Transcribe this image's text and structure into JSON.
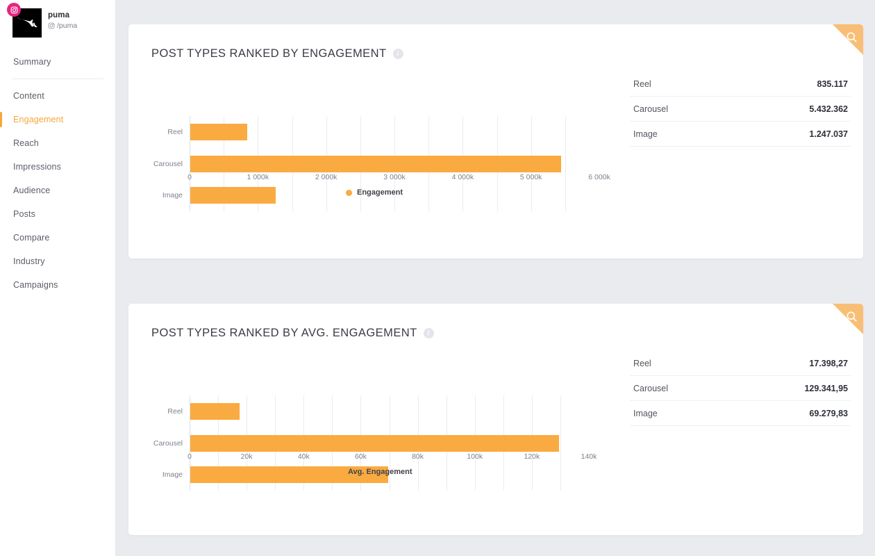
{
  "sidebar": {
    "profile": {
      "name": "puma",
      "handle": "/puma",
      "network_icon": "instagram-icon",
      "avatar_icon": "puma-logo"
    },
    "items": [
      {
        "label": "Summary",
        "active": false
      },
      {
        "label": "Content",
        "active": false
      },
      {
        "label": "Engagement",
        "active": true
      },
      {
        "label": "Reach",
        "active": false
      },
      {
        "label": "Impressions",
        "active": false
      },
      {
        "label": "Audience",
        "active": false
      },
      {
        "label": "Posts",
        "active": false
      },
      {
        "label": "Compare",
        "active": false
      },
      {
        "label": "Industry",
        "active": false
      },
      {
        "label": "Campaigns",
        "active": false
      }
    ]
  },
  "colors": {
    "accent": "#f5a73b",
    "bar": "#f9ab41",
    "corner": "#f9be75",
    "page_background": "#eaebef",
    "brand_badge": "#e6257e"
  },
  "cards": [
    {
      "title": "POST TYPES RANKED BY ENGAGEMENT",
      "info_icon": "info-icon",
      "corner_icon": "magnifier-icon",
      "table": {
        "rows": [
          {
            "name": "Reel",
            "value": "835.117"
          },
          {
            "name": "Carousel",
            "value": "5.432.362"
          },
          {
            "name": "Image",
            "value": "1.247.037"
          }
        ]
      }
    },
    {
      "title": "POST TYPES RANKED BY AVG. ENGAGEMENT",
      "info_icon": "info-icon",
      "corner_icon": "magnifier-icon",
      "table": {
        "rows": [
          {
            "name": "Reel",
            "value": "17.398,27"
          },
          {
            "name": "Carousel",
            "value": "129.341,95"
          },
          {
            "name": "Image",
            "value": "69.279,83"
          }
        ]
      }
    }
  ],
  "chart_data": [
    {
      "type": "bar",
      "orientation": "horizontal",
      "title": "POST TYPES RANKED BY ENGAGEMENT",
      "categories": [
        "Reel",
        "Carousel",
        "Image"
      ],
      "values": [
        835117,
        5432362,
        1247037
      ],
      "series": [
        {
          "name": "Engagement",
          "values": [
            835117,
            5432362,
            1247037
          ]
        }
      ],
      "legend": [
        "Engagement"
      ],
      "legend_position": "bottom",
      "xlabel": "",
      "ylabel": "",
      "xlim": [
        0,
        6000000
      ],
      "xtick_values": [
        0,
        1000000,
        2000000,
        3000000,
        4000000,
        5000000,
        6000000
      ],
      "xtick_labels": [
        "0",
        "1 000k",
        "2 000k",
        "3 000k",
        "4 000k",
        "5 000k",
        "6 000k"
      ],
      "minor_gridline_step": 500000,
      "grid": true,
      "bar_color": "#f9ab41"
    },
    {
      "type": "bar",
      "orientation": "horizontal",
      "title": "POST TYPES RANKED BY AVG. ENGAGEMENT",
      "categories": [
        "Reel",
        "Carousel",
        "Image"
      ],
      "values": [
        17398.27,
        129341.95,
        69279.83
      ],
      "series": [
        {
          "name": "Avg. Engagement",
          "values": [
            17398.27,
            129341.95,
            69279.83
          ]
        }
      ],
      "legend": [
        "Avg. Engagement"
      ],
      "legend_position": "bottom",
      "xlabel": "",
      "ylabel": "",
      "xlim": [
        0,
        140000
      ],
      "xtick_values": [
        0,
        20000,
        40000,
        60000,
        80000,
        100000,
        120000,
        140000
      ],
      "xtick_labels": [
        "0",
        "20k",
        "40k",
        "60k",
        "80k",
        "100k",
        "120k",
        "140k"
      ],
      "minor_gridline_step": 10000,
      "grid": true,
      "bar_color": "#f9ab41"
    }
  ]
}
